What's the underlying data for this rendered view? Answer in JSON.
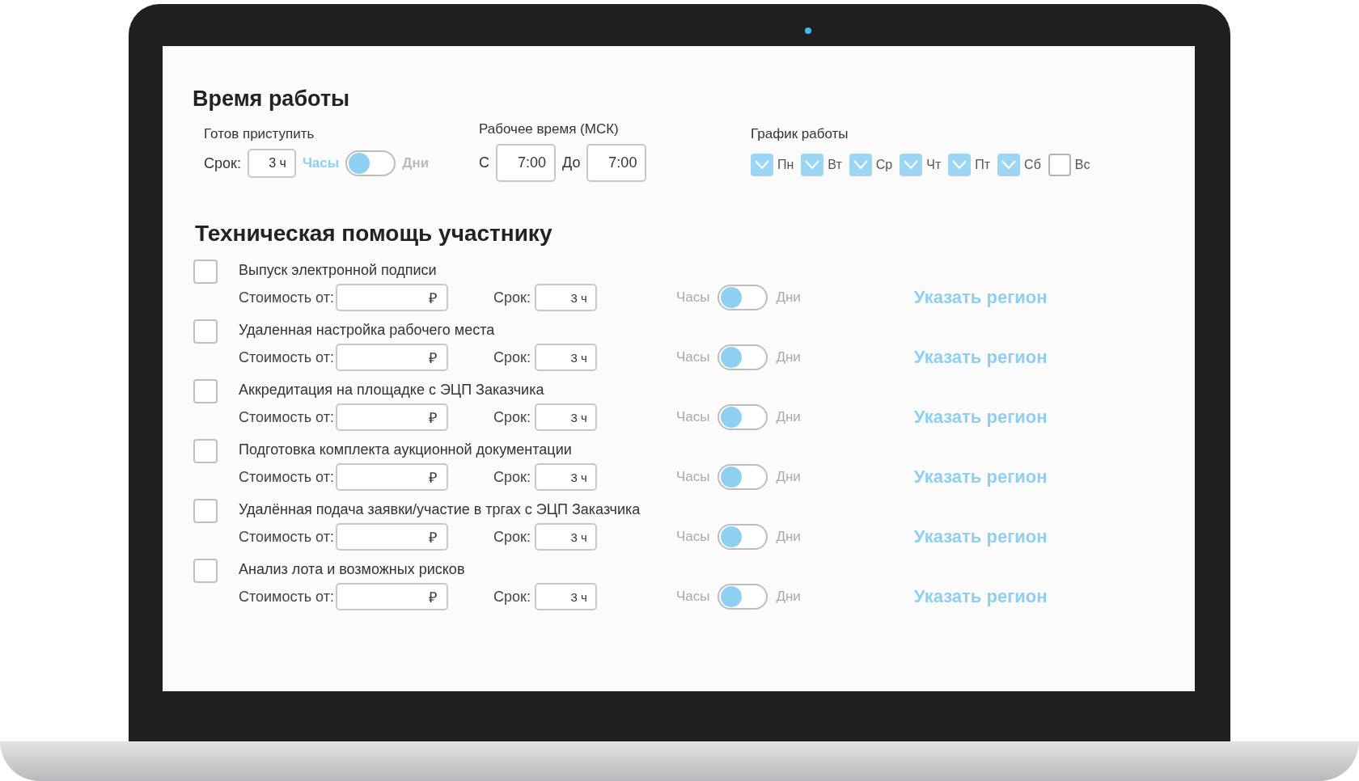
{
  "work_time": {
    "title": "Время работы",
    "ready": {
      "label": "Готов приступить",
      "term_label": "Срок:",
      "term_value": "3 ч",
      "toggle": {
        "left_label": "Часы",
        "right_label": "Дни",
        "days_selected": false,
        "disabled": false
      }
    },
    "hours": {
      "label": "Рабочее время (МСК)",
      "from_label": "С",
      "from_value": "7:00",
      "to_label": "До",
      "to_value": "7:00"
    },
    "schedule": {
      "label": "График работы",
      "days": [
        {
          "label": "Пн",
          "checked": true
        },
        {
          "label": "Вт",
          "checked": true
        },
        {
          "label": "Ср",
          "checked": true
        },
        {
          "label": "Чт",
          "checked": true
        },
        {
          "label": "Пт",
          "checked": true
        },
        {
          "label": "Сб",
          "checked": true
        },
        {
          "label": "Вс",
          "checked": false
        }
      ]
    }
  },
  "tech_help": {
    "title": "Техническая помощь участнику",
    "services": [
      {
        "name": "Выпуск электронной подписи",
        "checked": false,
        "cost_label": "Стоимость от:",
        "currency": "₽",
        "term_label": "Срок:",
        "term_value": "3 ч",
        "toggle": {
          "left_label": "Часы",
          "right_label": "Дни",
          "days_selected": false,
          "disabled": true
        },
        "region_link": "Указать регион"
      },
      {
        "name": "Удаленная настройка рабочего места",
        "checked": false,
        "cost_label": "Стоимость от:",
        "currency": "₽",
        "term_label": "Срок:",
        "term_value": "3 ч",
        "toggle": {
          "left_label": "Часы",
          "right_label": "Дни",
          "days_selected": false,
          "disabled": true
        },
        "region_link": "Указать регион"
      },
      {
        "name": "Аккредитация на площадке с ЭЦП Заказчика",
        "checked": false,
        "cost_label": "Стоимость от:",
        "currency": "₽",
        "term_label": "Срок:",
        "term_value": "3 ч",
        "toggle": {
          "left_label": "Часы",
          "right_label": "Дни",
          "days_selected": false,
          "disabled": true
        },
        "region_link": "Указать регион"
      },
      {
        "name": "Подготовка комплекта аукционной документации",
        "checked": false,
        "cost_label": "Стоимость от:",
        "currency": "₽",
        "term_label": "Срок:",
        "term_value": "3 ч",
        "toggle": {
          "left_label": "Часы",
          "right_label": "Дни",
          "days_selected": false,
          "disabled": true
        },
        "region_link": "Указать регион"
      },
      {
        "name": "Удалённая подача заявки/участие в тргах с ЭЦП Заказчика",
        "checked": false,
        "cost_label": "Стоимость от:",
        "currency": "₽",
        "term_label": "Срок:",
        "term_value": "3 ч",
        "toggle": {
          "left_label": "Часы",
          "right_label": "Дни",
          "days_selected": false,
          "disabled": true
        },
        "region_link": "Указать регион"
      },
      {
        "name": "Анализ лота и возможных рисков",
        "checked": false,
        "cost_label": "Стоимость от:",
        "currency": "₽",
        "term_label": "Срок:",
        "term_value": "3 ч",
        "toggle": {
          "left_label": "Часы",
          "right_label": "Дни",
          "days_selected": false,
          "disabled": true
        },
        "region_link": "Указать регион"
      }
    ]
  }
}
